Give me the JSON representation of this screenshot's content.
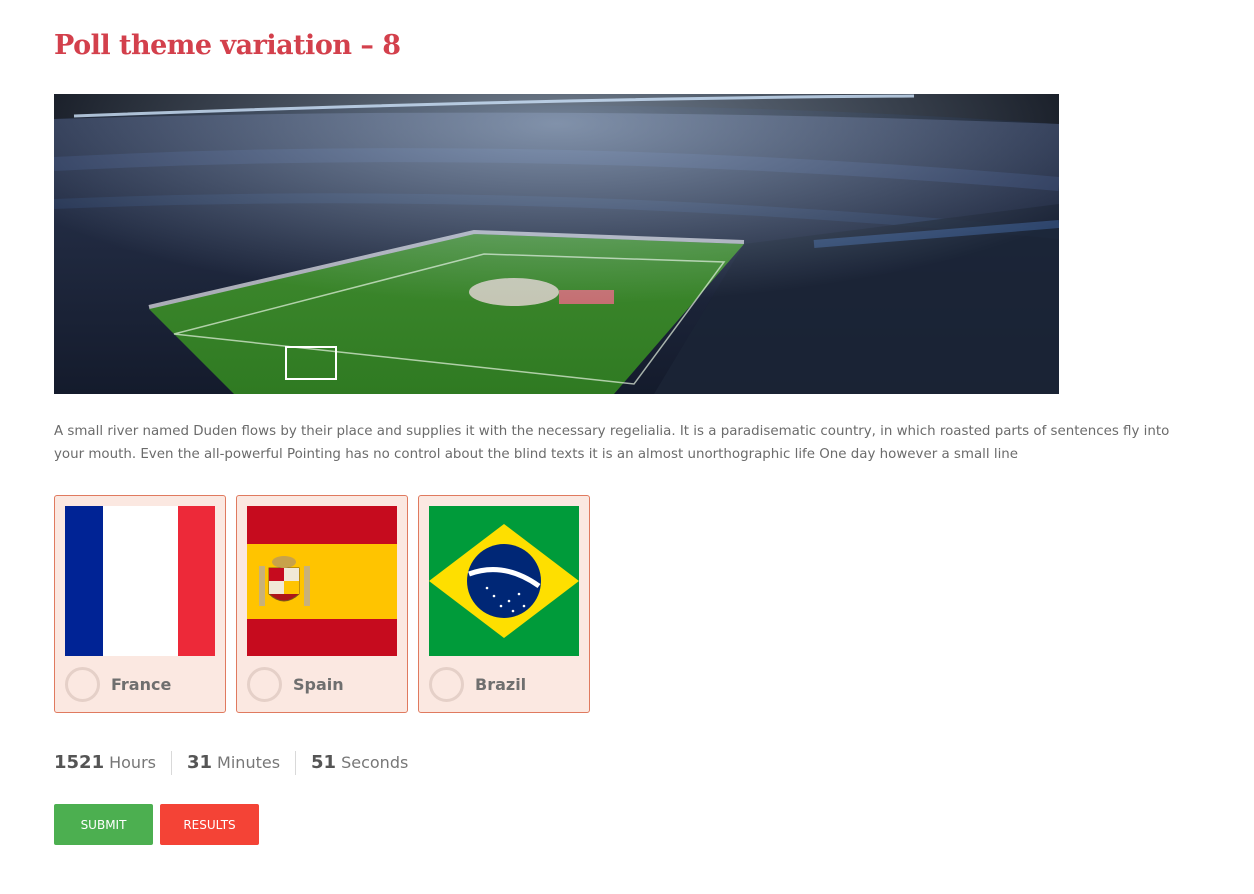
{
  "poll": {
    "title": "Poll theme variation – 8",
    "description": "A small river named Duden flows by their place and supplies it with the necessary regelialia. It is a paradisematic country, in which roasted parts of sentences fly into your mouth. Even the all-powerful Pointing has no control about the blind texts it is an almost unorthographic life One day however a small line",
    "options": [
      {
        "label": "France",
        "flag": "france-flag"
      },
      {
        "label": "Spain",
        "flag": "spain-flag"
      },
      {
        "label": "Brazil",
        "flag": "brazil-flag"
      }
    ]
  },
  "timer": {
    "hours": "1521",
    "hours_label": "Hours",
    "minutes": "31",
    "minutes_label": "Minutes",
    "seconds": "51",
    "seconds_label": "Seconds"
  },
  "buttons": {
    "submit_label": "SUBMIT",
    "results_label": "RESULTS"
  },
  "colors": {
    "title": "#d3404c",
    "option_bg": "#fbe8e1",
    "option_border": "#e07a5f",
    "submit": "#4caf50",
    "results": "#f44336"
  }
}
